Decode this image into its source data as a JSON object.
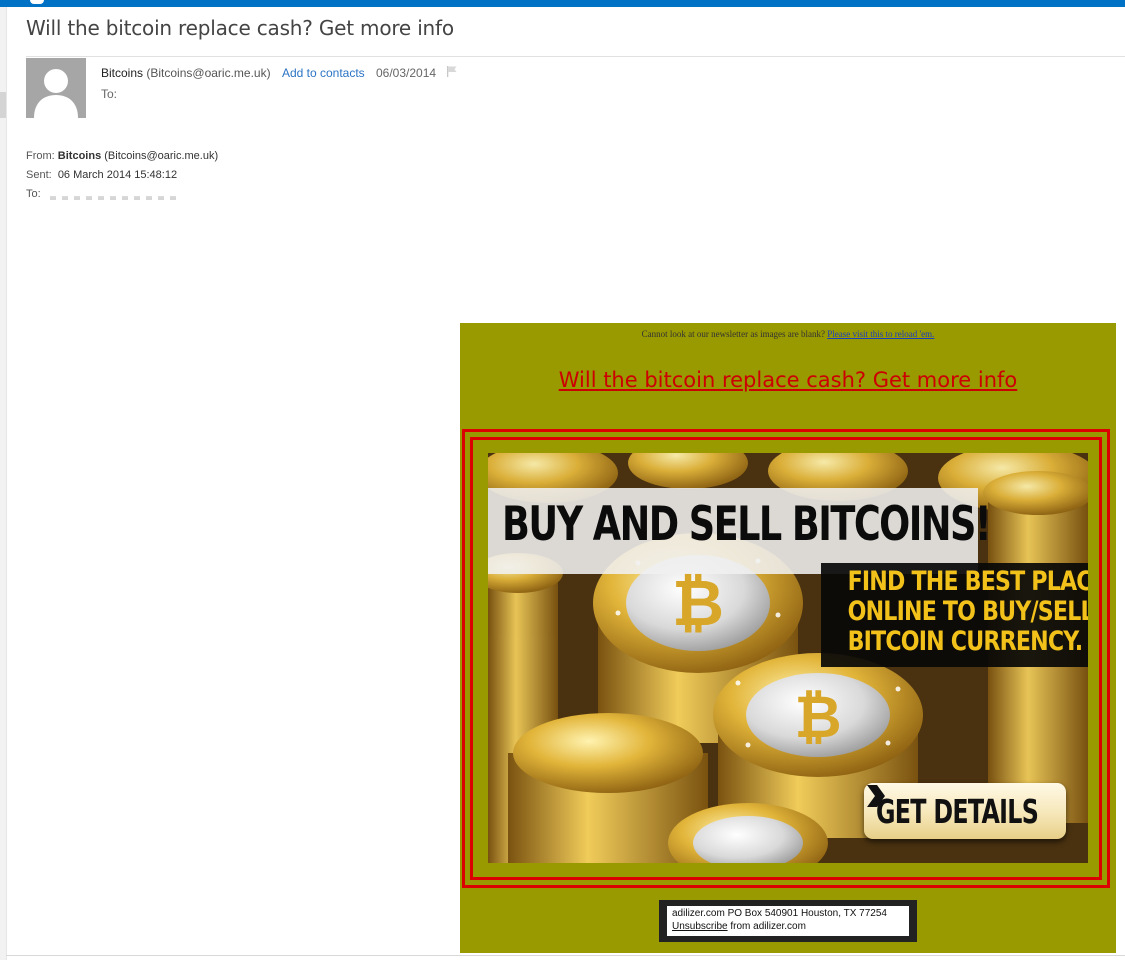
{
  "email": {
    "subject": "Will the bitcoin replace cash? Get more info",
    "sender_name": "Bitcoins",
    "sender_email": "(Bitcoins@oaric.me.uk)",
    "add_to_contacts": "Add to contacts",
    "date": "06/03/2014",
    "to_label": "To:",
    "header": {
      "from_label": "From:",
      "from_name": "Bitcoins",
      "from_email": "(Bitcoins@oaric.me.uk)",
      "sent_label": "Sent:",
      "sent_value": "06 March 2014 15:48:12",
      "to_label": "To:"
    }
  },
  "newsletter": {
    "notice_text": "Cannot look at our newsletter as images are blank?",
    "notice_link": "Please visit this to reload 'em.",
    "headline": "Will the bitcoin replace cash? Get more info",
    "banner_title": "BUY AND SELL BITCOINS!",
    "banner_sub_lines": [
      "FIND THE BEST PLACES",
      "ONLINE TO BUY/SELL",
      "BITCOIN CURRENCY."
    ],
    "cta_label": "GET DETAILS",
    "footer_address": "adilizer.com PO Box 540901 Houston, TX 77254",
    "footer_unsubscribe": "Unsubscribe",
    "footer_from": "from adilizer.com"
  },
  "colors": {
    "accent_blue": "#0072c6",
    "link_blue": "#2a74c5",
    "newsletter_bg": "#999900",
    "frame_red": "#dd0000",
    "banner_gold": "#f2c21a"
  }
}
